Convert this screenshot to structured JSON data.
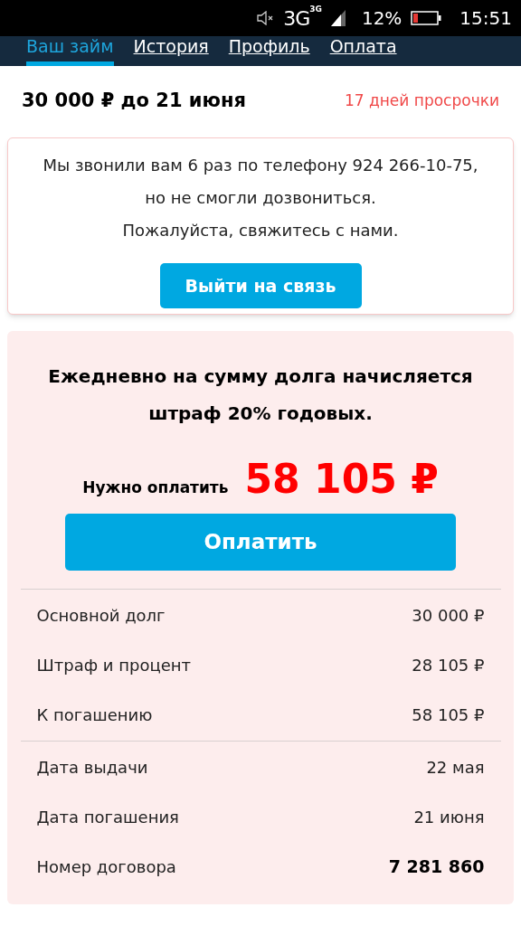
{
  "status_bar": {
    "network": "3G",
    "network_small": "3G",
    "battery_percent": "12%",
    "time": "15:51"
  },
  "tabs": [
    {
      "label": "Ваш займ",
      "selected": true
    },
    {
      "label": "История",
      "selected": false
    },
    {
      "label": "Профиль",
      "selected": false
    },
    {
      "label": "Оплата",
      "selected": false
    }
  ],
  "loan_header": {
    "title": "30 000 ₽ до 21 июня",
    "overdue": "17 дней просрочки"
  },
  "alert": {
    "lines": [
      "Мы звонили вам 6 раз по телефону 924 266-10-75, но не смогли дозвониться.",
      "Пожалуйста, свяжитесь с нами."
    ],
    "button": "Выйти на связь"
  },
  "payment": {
    "warning": "Ежедневно на сумму долга начисляется штраф 20% годовых.",
    "due_label": "Нужно оплатить",
    "due_amount": "58 105 ₽",
    "button": "Оплатить"
  },
  "details": [
    [
      {
        "label": "Основной долг",
        "value": "30 000 ₽",
        "bold": false
      },
      {
        "label": "Штраф и процент",
        "value": "28 105 ₽",
        "bold": false
      },
      {
        "label": "К погашению",
        "value": "58 105 ₽",
        "bold": false
      }
    ],
    [
      {
        "label": "Дата выдачи",
        "value": "22 мая",
        "bold": false
      },
      {
        "label": "Дата погашения",
        "value": "21 июня",
        "bold": false
      },
      {
        "label": "Номер договора",
        "value": "7 281 860",
        "bold": true
      }
    ]
  ]
}
